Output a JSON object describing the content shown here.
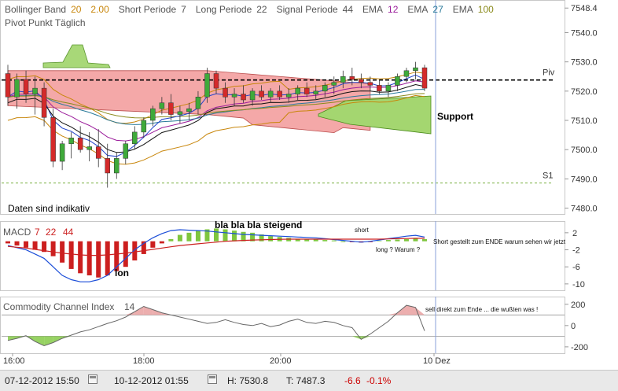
{
  "header": {
    "line1": [
      {
        "text": "Bollinger Band",
        "color": "#555555"
      },
      {
        "text": "20",
        "color": "#c8860b"
      },
      {
        "text": "2.00",
        "color": "#c8860b"
      },
      {
        "text": "Short Periode",
        "color": "#555555"
      },
      {
        "text": "7",
        "color": "#555555"
      },
      {
        "text": "Long Periode",
        "color": "#555555"
      },
      {
        "text": "22",
        "color": "#555555"
      },
      {
        "text": "Signal Periode",
        "color": "#555555"
      },
      {
        "text": "44",
        "color": "#555555"
      },
      {
        "text": "EMA",
        "color": "#555555"
      },
      {
        "text": "12",
        "color": "#9b1c9b"
      },
      {
        "text": "EMA",
        "color": "#555555"
      },
      {
        "text": "27",
        "color": "#2a7a9a"
      },
      {
        "text": "EMA",
        "color": "#555555"
      },
      {
        "text": "100",
        "color": "#8a8a1a"
      }
    ],
    "line2": "Pivot Punkt  Täglich"
  },
  "chart_data": [
    {
      "type": "candlestick",
      "yticks": [
        "7548.4",
        "7540.0",
        "7530.0",
        "7520.0",
        "7510.0",
        "7500.0",
        "7490.0",
        "7480.0"
      ],
      "ylim": [
        7478,
        7549
      ],
      "levels": [
        {
          "name": "Piv",
          "value": 7523.8
        },
        {
          "name": "S1",
          "value": 7488.6
        }
      ],
      "annotations": [
        "Support",
        "Daten sind indikativ"
      ],
      "candles": [
        [
          7526,
          7529,
          7515,
          7518
        ],
        [
          7518,
          7526,
          7514,
          7524
        ],
        [
          7524,
          7527,
          7516,
          7519
        ],
        [
          7519,
          7525,
          7512,
          7521
        ],
        [
          7521,
          7523,
          7508,
          7511
        ],
        [
          7511,
          7514,
          7494,
          7496
        ],
        [
          7496,
          7503,
          7493,
          7502
        ],
        [
          7502,
          7506,
          7497,
          7504
        ],
        [
          7504,
          7508,
          7499,
          7500
        ],
        [
          7500,
          7506,
          7496,
          7501
        ],
        [
          7501,
          7507,
          7494,
          7497
        ],
        [
          7497,
          7502,
          7487,
          7492
        ],
        [
          7492,
          7499,
          7490,
          7497
        ],
        [
          7497,
          7503,
          7495,
          7502
        ],
        [
          7502,
          7508,
          7500,
          7506
        ],
        [
          7506,
          7511,
          7504,
          7510
        ],
        [
          7510,
          7515,
          7508,
          7514
        ],
        [
          7514,
          7518,
          7512,
          7516
        ],
        [
          7516,
          7519,
          7510,
          7512
        ],
        [
          7512,
          7515,
          7509,
          7513
        ],
        [
          7513,
          7516,
          7510,
          7514
        ],
        [
          7514,
          7520,
          7512,
          7518
        ],
        [
          7518,
          7528,
          7516,
          7526
        ],
        [
          7526,
          7527,
          7519,
          7521
        ],
        [
          7521,
          7523,
          7516,
          7518
        ],
        [
          7518,
          7521,
          7515,
          7519
        ],
        [
          7519,
          7522,
          7516,
          7517
        ],
        [
          7517,
          7521,
          7515,
          7520
        ],
        [
          7520,
          7522,
          7517,
          7518
        ],
        [
          7518,
          7521,
          7516,
          7520
        ],
        [
          7520,
          7522,
          7517,
          7518
        ],
        [
          7518,
          7521,
          7516,
          7519
        ],
        [
          7519,
          7522,
          7517,
          7521
        ],
        [
          7521,
          7523,
          7518,
          7519
        ],
        [
          7519,
          7522,
          7517,
          7520
        ],
        [
          7520,
          7523,
          7518,
          7522
        ],
        [
          7522,
          7525,
          7519,
          7523
        ],
        [
          7523,
          7527,
          7521,
          7525
        ],
        [
          7525,
          7528,
          7522,
          7524
        ],
        [
          7524,
          7526,
          7521,
          7523
        ],
        [
          7523,
          7525,
          7520,
          7522
        ],
        [
          7522,
          7524,
          7519,
          7520
        ],
        [
          7520,
          7523,
          7518,
          7522
        ],
        [
          7522,
          7526,
          7520,
          7525
        ],
        [
          7525,
          7528,
          7523,
          7527
        ],
        [
          7527,
          7530,
          7524,
          7528
        ],
        [
          7528,
          7529,
          7520,
          7521
        ]
      ]
    },
    {
      "type": "bar",
      "title": "MACD",
      "params": [
        "7",
        "22",
        "44"
      ],
      "yticks": [
        "2",
        "-2",
        "-6",
        "-10"
      ],
      "ylim": [
        -11.5,
        4
      ],
      "histogram": [
        -0.5,
        -1,
        -1.5,
        -2,
        -2.5,
        -3.5,
        -5,
        -6.5,
        -7.5,
        -8,
        -8.5,
        -8,
        -7,
        -6,
        -4.5,
        -3,
        -1.5,
        -0.5,
        0.5,
        1.5,
        2,
        2.5,
        2.8,
        3,
        2.8,
        2.5,
        2.2,
        2,
        1.6,
        1.2,
        1,
        0.8,
        0.6,
        0.5,
        0.4,
        0.3,
        0.2,
        0,
        -0.2,
        -0.3,
        -0.2,
        0.1,
        0.3,
        0.4,
        0.5,
        0.6,
        0.5
      ],
      "macd_line": [
        -1,
        -1.5,
        -2,
        -3,
        -4,
        -6,
        -8,
        -9,
        -9.5,
        -9.5,
        -9,
        -8,
        -6,
        -4,
        -2,
        -0.5,
        0.8,
        1.8,
        2.5,
        2.7,
        2.6,
        2.5,
        2.4,
        2.2,
        2,
        1.8,
        1.6,
        1.5,
        1.4,
        1.3,
        1.2,
        1.1,
        1,
        0.9,
        0.8,
        0.6,
        0.4,
        0.2,
        0,
        -0.2,
        0,
        0.3,
        0.6,
        0.9,
        1.2,
        1.4,
        1
      ],
      "signal_line": [
        -1.2,
        -1.4,
        -1.6,
        -1.9,
        -2.2,
        -2.5,
        -2.8,
        -3,
        -3.2,
        -3.3,
        -3.3,
        -3.2,
        -3,
        -2.8,
        -2.5,
        -2.2,
        -1.9,
        -1.6,
        -1.3,
        -1,
        -0.8,
        -0.6,
        -0.4,
        -0.2,
        0,
        0.1,
        0.2,
        0.3,
        0.35,
        0.4,
        0.45,
        0.5,
        0.5,
        0.5,
        0.5,
        0.5,
        0.5,
        0.5,
        0.5,
        0.5,
        0.5,
        0.5,
        0.55,
        0.6,
        0.65,
        0.7,
        0.7
      ],
      "annotations": [
        "bla bla bla steigend",
        "short",
        "long ? Warum ?",
        "Short gestellt zum ENDE warum  sehen wir jetzt",
        "lon"
      ]
    },
    {
      "type": "line",
      "title": "Commodity Channel Index",
      "params": [
        "14"
      ],
      "yticks": [
        "200",
        "0",
        "-200"
      ],
      "ylim": [
        -260,
        250
      ],
      "bands": [
        100,
        -100
      ],
      "values": [
        -140,
        -120,
        -95,
        -150,
        -190,
        -160,
        -120,
        -90,
        -60,
        -40,
        -10,
        20,
        45,
        80,
        130,
        180,
        150,
        120,
        100,
        80,
        60,
        40,
        20,
        30,
        55,
        30,
        10,
        0,
        20,
        -10,
        5,
        40,
        60,
        30,
        20,
        40,
        30,
        0,
        -20,
        -130,
        -80,
        -20,
        40,
        120,
        190,
        170,
        -50
      ],
      "annotations": [
        "sell direkt zum Ende ... die wußten was !"
      ]
    }
  ],
  "x_axis": {
    "labels": [
      "16:00",
      "18:00",
      "20:00",
      "10 Dez"
    ]
  },
  "footer": {
    "from": "07-12-2012 15:50",
    "to": "10-12-2012 01:55",
    "high": "H: 7530.8",
    "low": "T: 7487.3",
    "change": "-6.6",
    "change_pct": "-0.1%",
    "change_color": "#cc0000"
  }
}
